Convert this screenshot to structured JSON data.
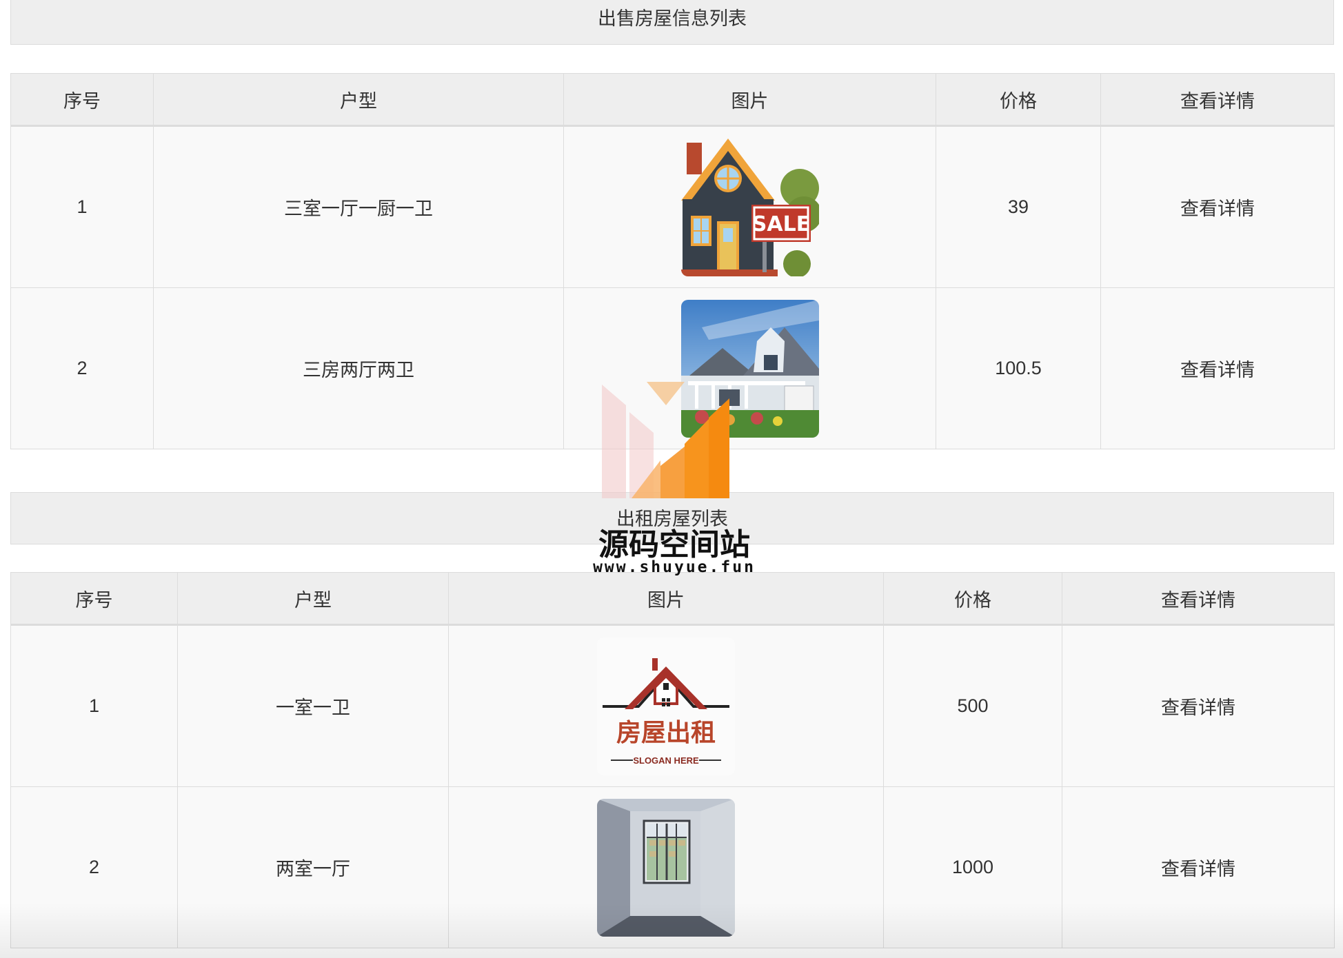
{
  "sale_section": {
    "title": "出售房屋信息列表",
    "headers": [
      "序号",
      "户型",
      "图片",
      "价格",
      "查看详情"
    ],
    "rows": [
      {
        "index": "1",
        "layout": "三室一厅一厨一卫",
        "image": "house-for-sale-sign-image",
        "price": "39",
        "detail": "查看详情"
      },
      {
        "index": "2",
        "layout": "三房两厅两卫",
        "image": "suburban-house-photo",
        "price": "100.5",
        "detail": "查看详情"
      }
    ]
  },
  "rent_section": {
    "title": "出租房屋列表",
    "headers": [
      "序号",
      "户型",
      "图片",
      "价格",
      "查看详情"
    ],
    "rows": [
      {
        "index": "1",
        "layout": "一室一卫",
        "image": "house-rent-logo-image",
        "logo_text": "房屋出租",
        "logo_slogan": "SLOGAN HERE",
        "price": "500",
        "detail": "查看详情"
      },
      {
        "index": "2",
        "layout": "两室一厅",
        "image": "empty-room-photo",
        "price": "1000",
        "detail": "查看详情"
      }
    ]
  },
  "watermark": {
    "name": "源码空间站",
    "url": "www.shuyue.fun"
  },
  "colors": {
    "header_bg": "#eeeeee",
    "row_bg": "#f9f9f9",
    "border": "#dcdcdc",
    "text": "#333333",
    "watermark_orange": "#f7941d",
    "watermark_pink": "#f2c9c9"
  }
}
